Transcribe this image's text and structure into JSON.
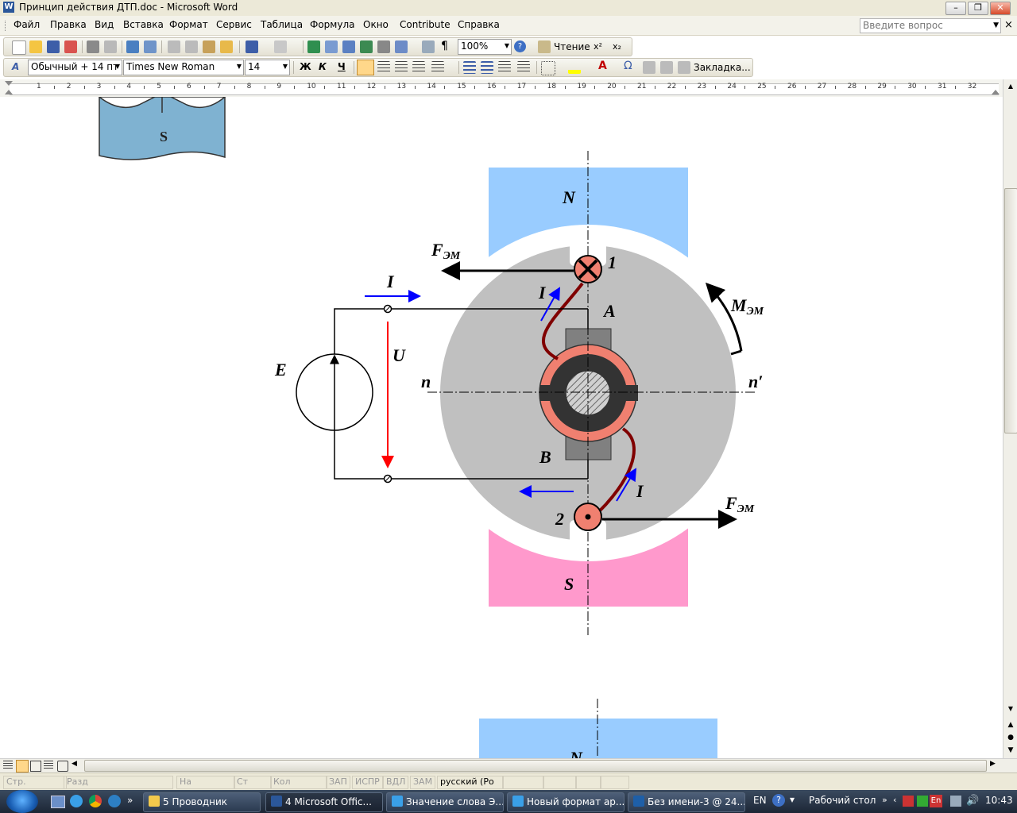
{
  "window": {
    "title": "Принцип действия ДТП.doc - Microsoft Word",
    "minimize": "–",
    "restore": "❐",
    "close": "✕"
  },
  "menu": {
    "items": [
      "Файл",
      "Правка",
      "Вид",
      "Вставка",
      "Формат",
      "Сервис",
      "Таблица",
      "Формула",
      "Окно",
      "Contribute",
      "Справка"
    ],
    "ask_placeholder": "Введите вопрос",
    "close_doc": "×"
  },
  "toolbar_standard": {
    "zoom": "100%",
    "reading_label": "Чтение",
    "superscript": "x²",
    "subscript": "x₂"
  },
  "toolbar_format": {
    "style": "Обычный + 14 пт",
    "font": "Times New Roman",
    "size": "14",
    "bold": "Ж",
    "italic": "К",
    "underline": "Ч",
    "bookmark": "Закладка...",
    "omega": "Ω"
  },
  "ruler": {
    "numbers": [
      "1",
      "2",
      "3",
      "4",
      "5",
      "6",
      "7",
      "8",
      "9",
      "10",
      "11",
      "12",
      "13",
      "14",
      "15",
      "16",
      "17",
      "18",
      "19",
      "20",
      "21",
      "22",
      "23",
      "24",
      "25",
      "26",
      "27",
      "28",
      "29",
      "30",
      "31",
      "32"
    ]
  },
  "diagram": {
    "label_N": "N",
    "label_S": "S",
    "label_S_top": "S",
    "label_N_next": "N",
    "label_F_top": "F",
    "label_F_top_sub": "ЭМ",
    "label_F_bottom": "F",
    "label_F_bottom_sub": "ЭМ",
    "label_M": "M",
    "label_M_sub": "ЭМ",
    "label_I_top": "I",
    "label_I_coil_top": "I",
    "label_I_coil_bottom": "I",
    "label_U": "U",
    "label_E": "E",
    "label_n": "n",
    "label_n_prime": "n′",
    "label_A": "A",
    "label_B": "B",
    "label_1": "1",
    "label_2": "2",
    "colors": {
      "pole_north": "#99ccff",
      "pole_south": "#ff99cc",
      "rotor": "#c0c0c0",
      "commutator": "#f08070",
      "wire": "#800000",
      "current_arrow": "#0000ff",
      "voltage_arrow": "#ff0000"
    }
  },
  "status": {
    "page": "Стр.",
    "section": "Разд",
    "at": "На",
    "line": "Ст",
    "col": "Кол",
    "rec": "ЗАП",
    "trk": "ИСПР",
    "ext": "ВДЛ",
    "ovr": "ЗАМ",
    "language": "русский (Ро"
  },
  "taskbar": {
    "tasks": [
      {
        "label": "5 Проводник",
        "icon": "folder-icon",
        "color": "#f2c94c"
      },
      {
        "label": "4 Microsoft Offic...",
        "icon": "word-icon",
        "color": "#2b579a"
      },
      {
        "label": "Значение слова Э...",
        "icon": "ie-icon",
        "color": "#3aa0e8"
      },
      {
        "label": "Новый формат ар...",
        "icon": "ie-icon",
        "color": "#3aa0e8"
      },
      {
        "label": "Без имени-3 @ 24...",
        "icon": "photoshop-icon",
        "color": "#1e5fa8"
      }
    ],
    "lang": "EN",
    "desktop": "Рабочий стол",
    "kbd": "En",
    "time": "10:43"
  }
}
